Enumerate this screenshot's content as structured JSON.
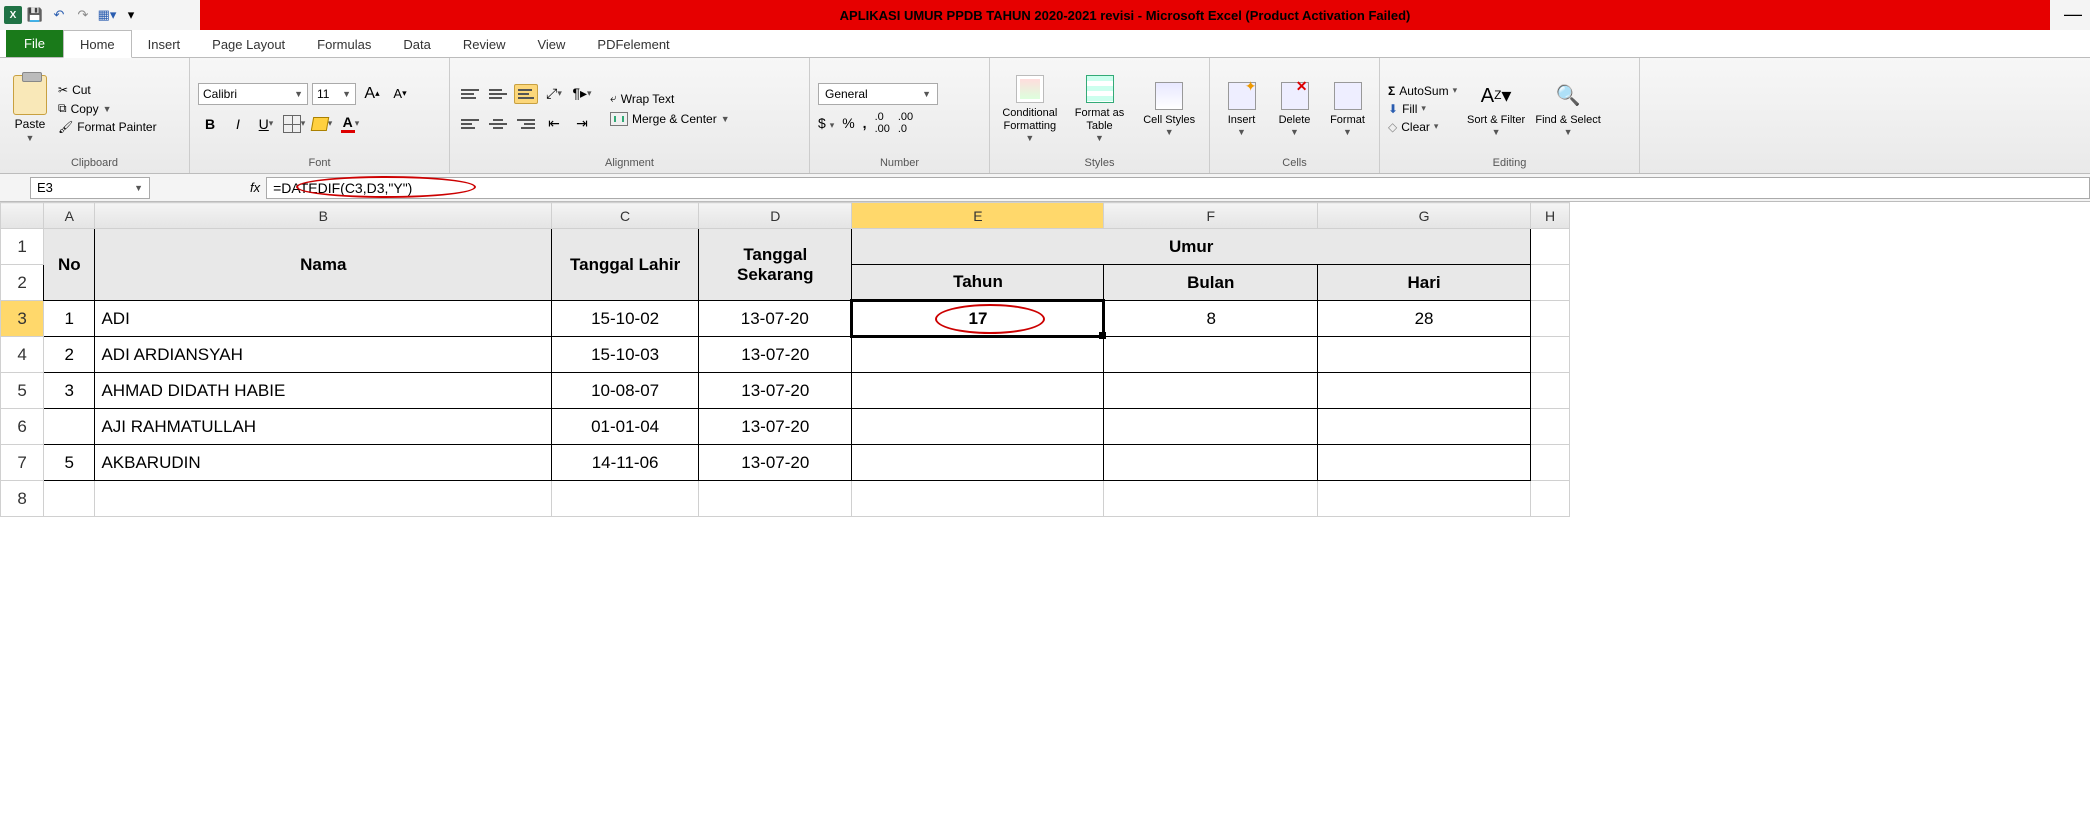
{
  "title": "APLIKASI UMUR PPDB TAHUN 2020-2021 revisi  -  Microsoft Excel (Product Activation Failed)",
  "tabs": {
    "file": "File",
    "home": "Home",
    "insert": "Insert",
    "page": "Page Layout",
    "formulas": "Formulas",
    "data": "Data",
    "review": "Review",
    "view": "View",
    "pdf": "PDFelement"
  },
  "ribbon": {
    "paste": "Paste",
    "cut": "Cut",
    "copy": "Copy",
    "fp": "Format Painter",
    "clipboard": "Clipboard",
    "fontname": "Calibri",
    "fontsize": "11",
    "fontgroup": "Font",
    "wrap": "Wrap Text",
    "merge": "Merge & Center",
    "aligngroup": "Alignment",
    "numfmt": "General",
    "numgroup": "Number",
    "cond": "Conditional Formatting",
    "fat": "Format as Table",
    "cellst": "Cell Styles",
    "stylesgroup": "Styles",
    "insert": "Insert",
    "delete": "Delete",
    "format": "Format",
    "cellsgroup": "Cells",
    "autosum": "AutoSum",
    "fill": "Fill",
    "clear": "Clear",
    "sort": "Sort & Filter",
    "find": "Find & Select",
    "editgroup": "Editing"
  },
  "namebox": "E3",
  "formula": "=DATEDIF(C3,D3,\"Y\")",
  "cols": {
    "A": "A",
    "B": "B",
    "C": "C",
    "D": "D",
    "E": "E",
    "F": "F",
    "G": "G",
    "H": "H"
  },
  "headers": {
    "no": "No",
    "nama": "Nama",
    "tgl_lahir": "Tanggal Lahir",
    "tgl_sekarang": "Tanggal Sekarang",
    "umur": "Umur",
    "tahun": "Tahun",
    "bulan": "Bulan",
    "hari": "Hari"
  },
  "rows": [
    {
      "no": "1",
      "nama": "ADI",
      "lahir": "15-10-02",
      "sekarang": "13-07-20",
      "tahun": "17",
      "bulan": "8",
      "hari": "28"
    },
    {
      "no": "2",
      "nama": "ADI ARDIANSYAH",
      "lahir": "15-10-03",
      "sekarang": "13-07-20",
      "tahun": "",
      "bulan": "",
      "hari": ""
    },
    {
      "no": "3",
      "nama": "AHMAD DIDATH HABIE",
      "lahir": "10-08-07",
      "sekarang": "13-07-20",
      "tahun": "",
      "bulan": "",
      "hari": ""
    },
    {
      "no": "",
      "nama": "AJI RAHMATULLAH",
      "lahir": "01-01-04",
      "sekarang": "13-07-20",
      "tahun": "",
      "bulan": "",
      "hari": ""
    },
    {
      "no": "5",
      "nama": "AKBARUDIN",
      "lahir": "14-11-06",
      "sekarang": "13-07-20",
      "tahun": "",
      "bulan": "",
      "hari": ""
    }
  ]
}
